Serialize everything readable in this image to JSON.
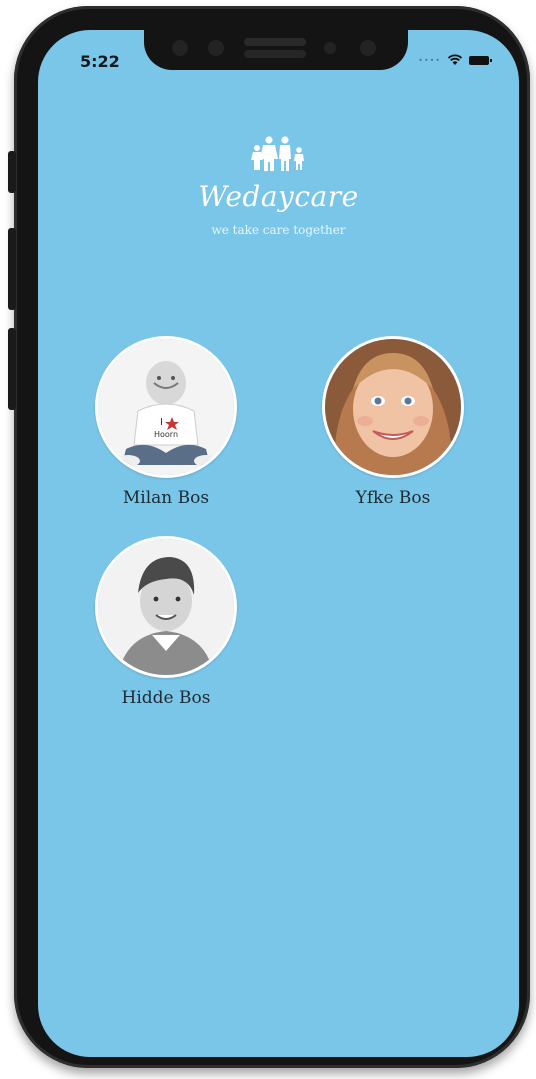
{
  "status_bar": {
    "time": "5:22",
    "signal_icon": "signal-dots-icon",
    "wifi_icon": "wifi-icon",
    "battery_icon": "battery-icon"
  },
  "branding": {
    "icon": "family-icon",
    "name": "Wedaycare",
    "tagline": "we take care together"
  },
  "children": [
    {
      "name": "Milan Bos",
      "photo": "baby-photo"
    },
    {
      "name": "Yfke Bos",
      "photo": "girl-photo"
    },
    {
      "name": "Hidde Bos",
      "photo": "boy-photo"
    }
  ],
  "colors": {
    "background": "#79c6e9",
    "text_dark": "#1f2a30",
    "brand_white": "#ffffff"
  }
}
